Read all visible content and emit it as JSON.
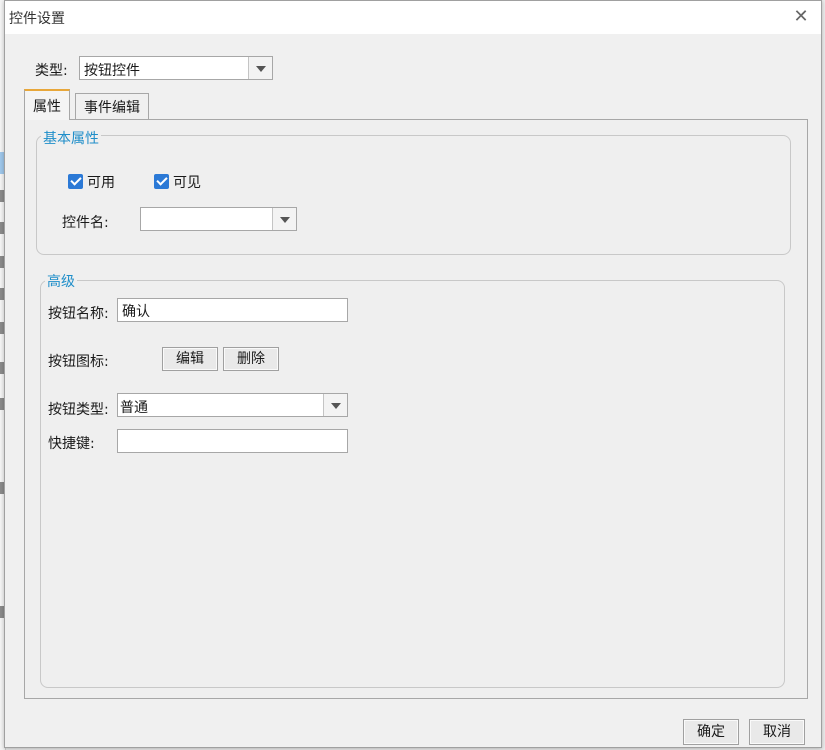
{
  "dialog": {
    "title": "控件设置",
    "close_glyph": "✕"
  },
  "type_row": {
    "label": "类型:",
    "selected": "按钮控件"
  },
  "tabs": [
    {
      "label": "属性",
      "active": true
    },
    {
      "label": "事件编辑",
      "active": false
    }
  ],
  "basic": {
    "legend": "基本属性",
    "enabled_label": "可用",
    "enabled_checked": true,
    "visible_label": "可见",
    "visible_checked": true,
    "control_name_label": "控件名:",
    "control_name_value": ""
  },
  "advanced": {
    "legend": "高级",
    "button_name_label": "按钮名称:",
    "button_name_value": "确认",
    "button_icon_label": "按钮图标:",
    "edit_label": "编辑",
    "delete_label": "删除",
    "button_type_label": "按钮类型:",
    "button_type_value": "普通",
    "hotkey_label": "快捷键:",
    "hotkey_value": ""
  },
  "footer": {
    "ok_label": "确定",
    "cancel_label": "取消"
  },
  "colors": {
    "accent_tab": "#e8a73a",
    "legend_text": "#1f8ec9",
    "checkbox": "#2b79d6"
  }
}
